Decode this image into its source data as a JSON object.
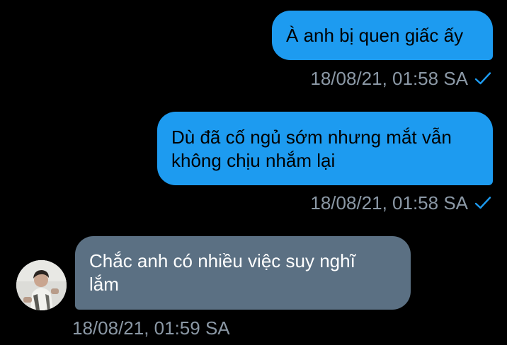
{
  "messages": [
    {
      "direction": "outgoing",
      "text": "À anh bị quen giấc ấy",
      "timestamp": "18/08/21, 01:58 SA",
      "status_icon": "check-icon"
    },
    {
      "direction": "outgoing",
      "text": "Dù đã cố ngủ sớm nhưng mắt vẫn\nkhông chịu nhắm lại",
      "timestamp": "18/08/21, 01:58 SA",
      "status_icon": "check-icon"
    },
    {
      "direction": "incoming",
      "text": "Chắc anh có nhiều việc suy nghĩ\nlắm",
      "timestamp": "18/08/21, 01:59 SA",
      "avatar_icon": "avatar"
    }
  ],
  "colors": {
    "background": "#000000",
    "outgoing_bubble": "#1D9BF0",
    "incoming_bubble": "#5B7083",
    "timestamp_text": "#8B98A5",
    "read_check": "#1D9BF0"
  }
}
